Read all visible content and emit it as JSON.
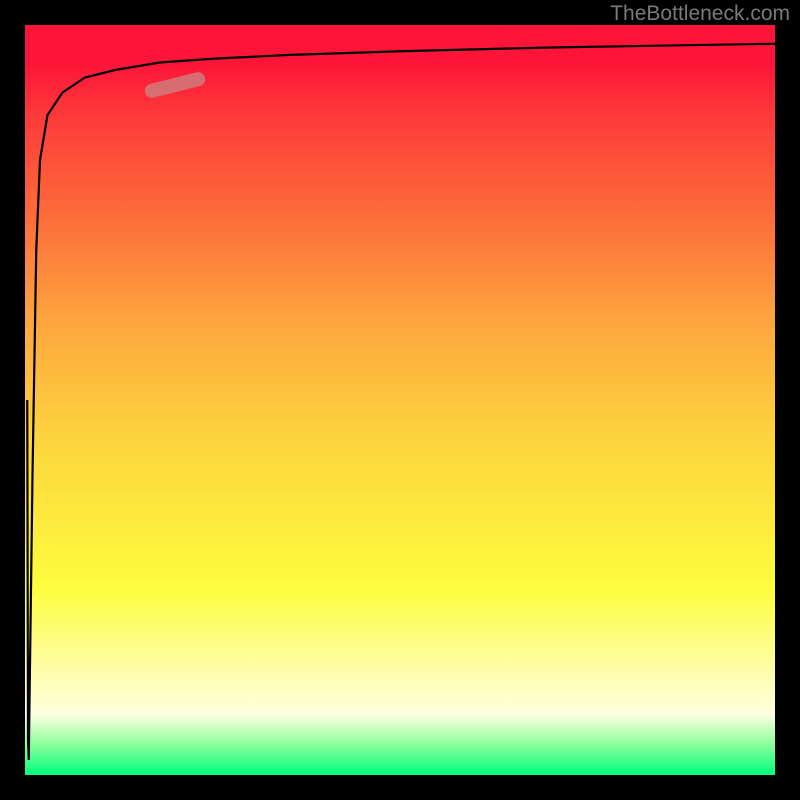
{
  "watermark": "TheBottleneck.com",
  "chart_data": {
    "type": "line",
    "title": "",
    "xlabel": "",
    "ylabel": "",
    "xlim": [
      0,
      100
    ],
    "ylim": [
      0,
      100
    ],
    "grid": false,
    "series": [
      {
        "name": "curve",
        "x": [
          0.5,
          1,
          1.5,
          2,
          3,
          5,
          8,
          12,
          18,
          25,
          35,
          50,
          70,
          100
        ],
        "values": [
          2,
          40,
          70,
          82,
          88,
          91,
          93,
          94,
          95,
          95.5,
          96,
          96.5,
          97,
          97.5
        ]
      }
    ],
    "colors": {
      "curve": "#000000",
      "marker_fill": "#cf7b7b",
      "marker_stroke": "#cf7b7b"
    },
    "marker": {
      "x1": 16,
      "y1": 91,
      "x2": 24,
      "y2": 93
    }
  }
}
